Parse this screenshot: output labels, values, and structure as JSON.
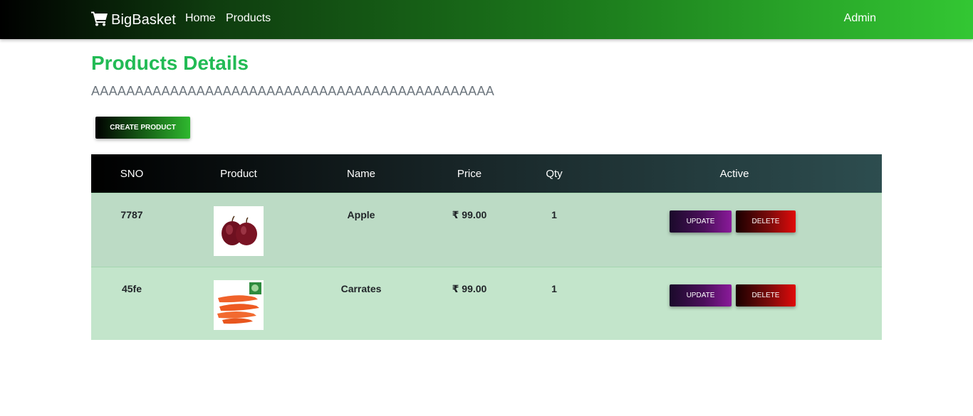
{
  "nav": {
    "brand": "BigBasket",
    "brand_icon": "shopping-cart-icon",
    "links": [
      "Home",
      "Products"
    ],
    "user": "Admin"
  },
  "page": {
    "title": "Products Details",
    "subtitle": "AAAAAAAAAAAAAAAAAAAAAAAAAAAAAAAAAAAAAAAAAAAAAA",
    "create_button": "CREATE PRODUCT"
  },
  "table": {
    "headers": [
      "SNO",
      "Product",
      "Name",
      "Price",
      "Qty",
      "Active"
    ],
    "rows": [
      {
        "sno": "7787",
        "image": "apple-image",
        "name": "Apple",
        "price": "₹ 99.00",
        "qty": "1",
        "update": "UPDATE",
        "delete": "DELETE"
      },
      {
        "sno": "45fe",
        "image": "carrot-image",
        "name": "Carrates",
        "price": "₹ 99.00",
        "qty": "1",
        "update": "UPDATE",
        "delete": "DELETE"
      }
    ]
  },
  "colors": {
    "title_green": "#22bb55",
    "row_odd": "#bcdbc5",
    "row_even": "#c3e5cb",
    "update_accent": "#8a1a9a",
    "delete_accent": "#e00a0a"
  }
}
